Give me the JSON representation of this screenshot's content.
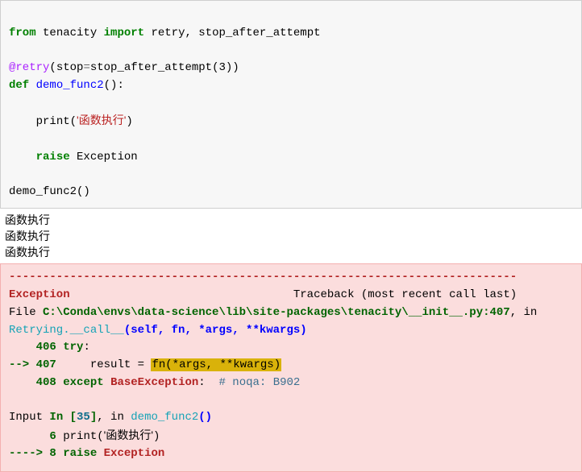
{
  "code": {
    "kw_from": "from",
    "mod": "tenacity",
    "kw_import": "import",
    "imports": "retry, stop_after_attempt",
    "dec_at": "@retry",
    "dec_lp": "(",
    "dec_kwarg": "stop",
    "dec_eq": "=",
    "dec_call": "stop_after_attempt",
    "dec_arg_lp": "(",
    "dec_arg": "3",
    "dec_arg_rp": ")",
    "dec_rp": ")",
    "kw_def": "def",
    "funcname": "demo_func2",
    "def_parens": "():",
    "print_name": "print",
    "print_lp": "(",
    "print_arg": "'函数执行'",
    "print_rp": ")",
    "kw_raise": "raise",
    "exc": "Exception",
    "call_name": "demo_func2",
    "call_parens": "()"
  },
  "stdout": {
    "line1": "函数执行",
    "line2": "函数执行",
    "line3": "函数执行"
  },
  "tb": {
    "dashes": "---------------------------------------------------------------------------",
    "exc_name": "Exception",
    "tb_label": "Traceback (most recent call last)",
    "file_word": "File ",
    "file_path": "C:\\Conda\\envs\\data-science\\lib\\site-packages\\tenacity\\__init__.py:407",
    "file_in": ", in ",
    "frame1_cls": "Retrying.__call__",
    "frame1_sig": "(self, fn, *args, **kwargs)",
    "ln406": "406",
    "ln406_kw": "try",
    "ln406_colon": ":",
    "arrow407": "--> ",
    "ln407": "407",
    "ln407_pre": "     result ",
    "ln407_eq": "=",
    "ln407_sp": " ",
    "ln407_hl": "fn(*args, **kwargs)",
    "ln408": "408",
    "ln408_kw": "except",
    "ln408_exc": "BaseException",
    "ln408_colon": ":",
    "ln408_comment": "  # noqa: B902",
    "input_word": "Input ",
    "input_in": "In [",
    "input_num": "35",
    "input_close": "]",
    "input_comma": ", in ",
    "frame2_name": "demo_func2",
    "frame2_sig": "()",
    "ln6": "6",
    "ln6_print": "print",
    "ln6_lp": "(",
    "ln6_str": "'函数执行'",
    "ln6_rp": ")",
    "arrow8": "----> ",
    "ln8": "8",
    "ln8_raise": "raise",
    "ln8_exc": "Exception"
  }
}
